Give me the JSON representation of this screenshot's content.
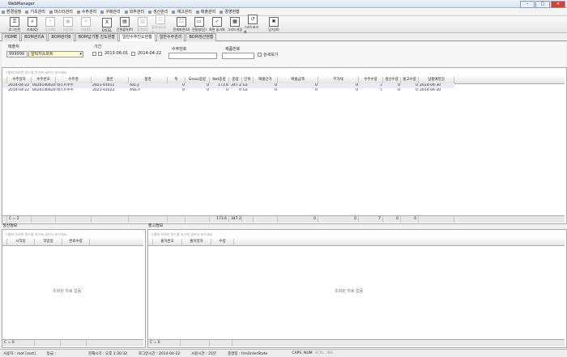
{
  "window": {
    "title": "WebManager"
  },
  "menu": [
    "환경설정",
    "기초관리",
    "마스터관리",
    "수주관리",
    "구매관리",
    "외주관리",
    "생산관리",
    "재고관리",
    "매출관리",
    "경영현황"
  ],
  "toolbar": [
    {
      "label": "로그인칸",
      "icon": "login-icon",
      "enabled": true
    },
    {
      "label": "조회(Q)",
      "icon": "search-icon",
      "enabled": true
    },
    {
      "label": "추가(N)",
      "icon": "add-icon",
      "enabled": false
    },
    {
      "label": "저장(S)",
      "icon": "save-icon",
      "enabled": false
    },
    {
      "label": "삭제(D)",
      "icon": "delete-icon",
      "enabled": false
    },
    {
      "label": "EXCEL",
      "icon": "excel-icon",
      "enabled": true
    },
    {
      "label": "간편출력(P)",
      "icon": "print-icon",
      "enabled": true
    },
    {
      "label": "출력(O)",
      "icon": "printer-icon",
      "enabled": false
    },
    {
      "label": "출력미리보기",
      "icon": "preview-icon",
      "enabled": false
    },
    {
      "label": "전체화면(U)",
      "icon": "fullscreen-icon",
      "enabled": true
    },
    {
      "label": "전용창(단)",
      "icon": "window-icon",
      "enabled": true
    },
    {
      "label": "화면 돌기화",
      "icon": "check-icon",
      "enabled": true
    },
    {
      "label": "그리드저장",
      "icon": "grid-save-icon",
      "enabled": true
    },
    {
      "label": "그리드초기화",
      "icon": "grid-reset-icon",
      "enabled": true
    },
    {
      "label": "닫기(X)",
      "icon": "close-icon",
      "enabled": true
    }
  ],
  "tabs": [
    "HOME",
    "BOM관리A",
    "BOM관리B",
    "BOM납기별 진도현황",
    "일반수주진도현황",
    "일반수주관리",
    "BOM생산현황"
  ],
  "active_tab": 4,
  "filter": {
    "customer_label": "매출처",
    "customer_code": "999999",
    "customer_name": "알틱지소프트",
    "period_label": "기간",
    "date_from": "2013-06-01",
    "date_to": "2014-04-22",
    "order_no_label": "수주번호",
    "product_no_label": "제품번호",
    "detail_label": "상세보기"
  },
  "group_hint": "그룹화 하려면 필드를 여기에 끌어다 놓으세요",
  "main_grid": {
    "columns": [
      "수주일자",
      "수주번호",
      "수주명",
      "품번",
      "품명",
      "폭",
      "Gross중량",
      "Net중량",
      "중량",
      "단위",
      "매출단가",
      "매출금액",
      "부가세",
      "수주수량",
      "생산수량",
      "출고수량",
      "납품예정일"
    ],
    "rows": [
      [
        "2014-04-22",
        "002014042001",
        "테스트수주",
        "2021-01011",
        "Ass.y",
        "0",
        "0",
        "173.6",
        "347.2",
        "Ea",
        "0",
        "0",
        "0",
        "2",
        "0",
        "0",
        "2014-04-30"
      ],
      [
        "2014-04-22",
        "002014042001",
        "테스트수주",
        "2021-01022",
        "ASS.Y",
        "0",
        "0",
        "0",
        "0",
        "Ea",
        "0",
        "0",
        "0",
        "5",
        "0",
        "0",
        "2014-04-30"
      ]
    ],
    "footer": {
      "count": "C = 2",
      "net": "173.6",
      "weight": "347.2",
      "amount": "0",
      "vat": "0",
      "qty": "7",
      "prod": "0",
      "ship": "0"
    }
  },
  "production_panel": {
    "title": "생산정보",
    "columns": [
      "시작일",
      "작업일",
      "완료수량"
    ],
    "empty": "조회된 자료 없음",
    "count": "C = 0"
  },
  "shipping_panel": {
    "title": "출고정보",
    "columns": [
      "출하번호",
      "출하일자",
      "수량"
    ],
    "empty": "조회된 자료 없음",
    "count": "C = 0"
  },
  "status": {
    "user": "사용자 : root [root]",
    "grade": "등급 :",
    "now": "현재시각 : 오후 1:30:32",
    "login": "로그인시간 : 2014-04-22",
    "elapsed": "사용시간 : 21분",
    "form": "종명칭 : frmOrderState",
    "caps": "CAPS",
    "num": "NUM",
    "scrl": "SCRL",
    "ins": "INS"
  }
}
